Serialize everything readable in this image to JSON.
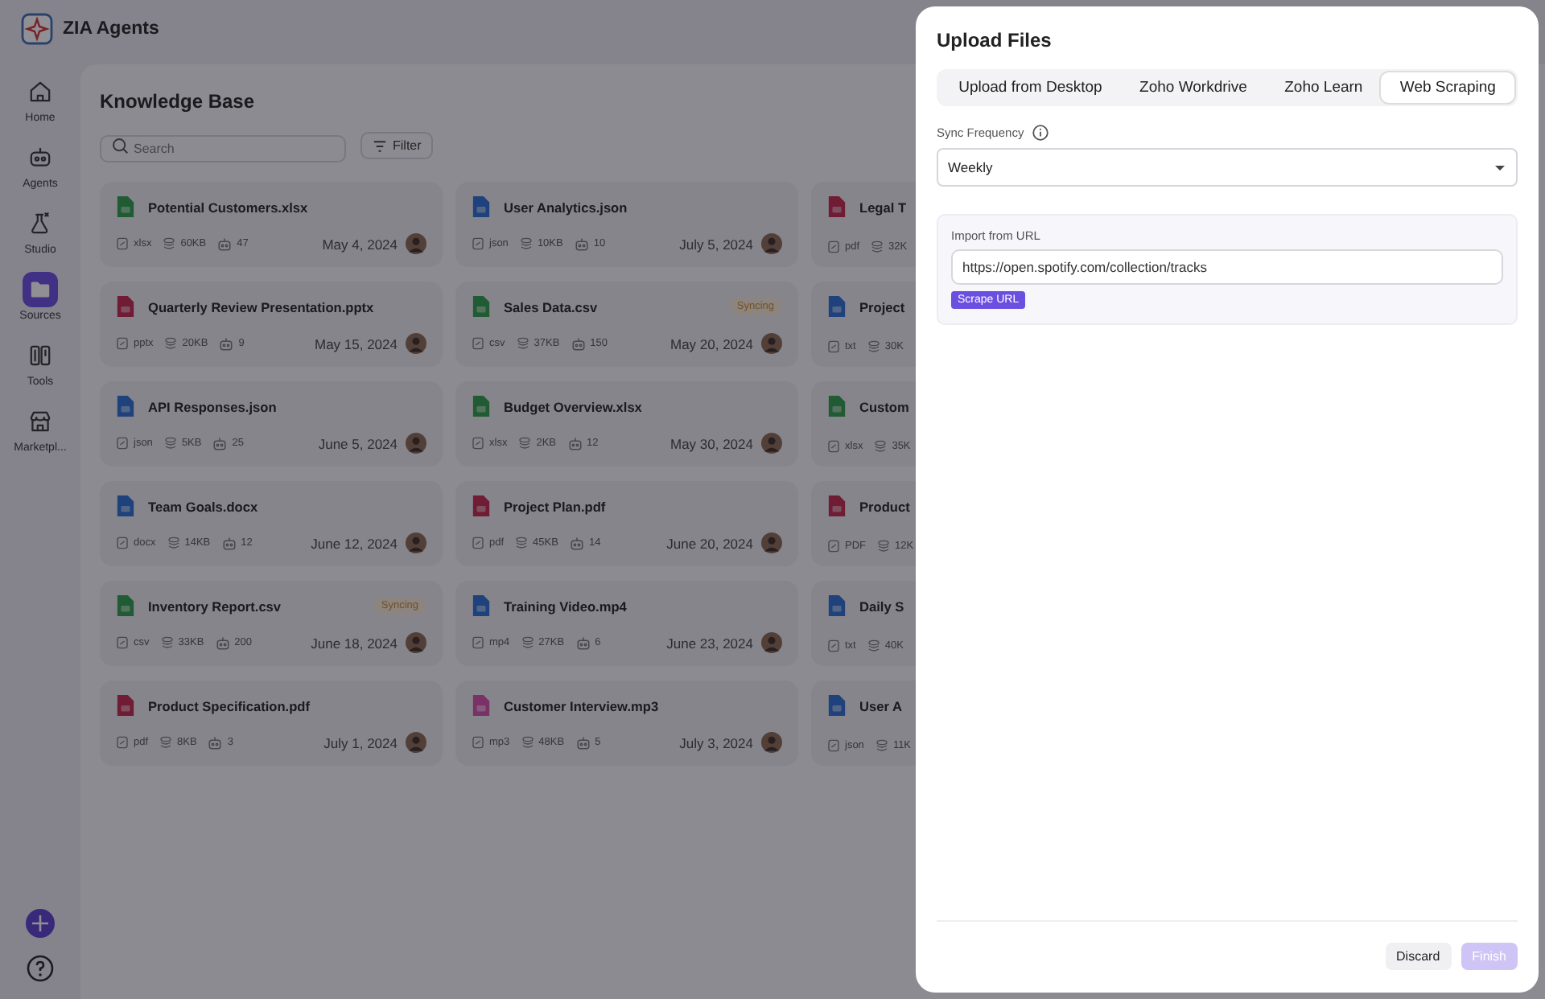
{
  "app": {
    "name": "ZIA Agents"
  },
  "sidebar": {
    "items": [
      {
        "label": "Home",
        "selected": false
      },
      {
        "label": "Agents",
        "selected": false
      },
      {
        "label": "Studio",
        "selected": false
      },
      {
        "label": "Sources",
        "selected": true
      },
      {
        "label": "Tools",
        "selected": false
      },
      {
        "label": "Marketpl...",
        "selected": false
      }
    ]
  },
  "page": {
    "title": "Knowledge Base",
    "search": {
      "placeholder": "Search"
    },
    "filter_button": "Filter"
  },
  "files": [
    {
      "name": "Potential Customers.xlsx",
      "kind": "sheet",
      "ext": "xlsx",
      "size": "60KB",
      "count": "47",
      "date": "May 4, 2024"
    },
    {
      "name": "User Analytics.json",
      "kind": "code",
      "ext": "json",
      "size": "10KB",
      "count": "10",
      "date": "July 5, 2024"
    },
    {
      "name": "Legal T",
      "kind": "pdf",
      "ext": "pdf",
      "size": "32K"
    },
    {
      "name": "Quarterly Review Presentation.pptx",
      "kind": "slides",
      "ext": "pptx",
      "size": "20KB",
      "count": "9",
      "date": "May 15, 2024"
    },
    {
      "name": "Sales Data.csv",
      "kind": "sheet",
      "ext": "csv",
      "size": "37KB",
      "count": "150",
      "date": "May 20, 2024",
      "badge": "Syncing"
    },
    {
      "name": "Project",
      "kind": "doc",
      "ext": "txt",
      "size": "30K"
    },
    {
      "name": "API Responses.json",
      "kind": "code",
      "ext": "json",
      "size": "5KB",
      "count": "25",
      "date": "June 5, 2024"
    },
    {
      "name": "Budget Overview.xlsx",
      "kind": "sheet",
      "ext": "xlsx",
      "size": "2KB",
      "count": "12",
      "date": "May 30, 2024"
    },
    {
      "name": "Custom",
      "kind": "sheet",
      "ext": "xlsx",
      "size": "35K"
    },
    {
      "name": "Team Goals.docx",
      "kind": "doc",
      "ext": "docx",
      "size": "14KB",
      "count": "12",
      "date": "June 12, 2024"
    },
    {
      "name": "Project Plan.pdf",
      "kind": "pdf",
      "ext": "pdf",
      "size": "45KB",
      "count": "14",
      "date": "June 20, 2024"
    },
    {
      "name": "Product",
      "kind": "slides",
      "ext": "PDF",
      "size": "12K"
    },
    {
      "name": "Inventory Report.csv",
      "kind": "sheet",
      "ext": "csv",
      "size": "33KB",
      "count": "200",
      "date": "June 18, 2024",
      "badge": "Syncing"
    },
    {
      "name": "Training Video.mp4",
      "kind": "video",
      "ext": "mp4",
      "size": "27KB",
      "count": "6",
      "date": "June 23, 2024"
    },
    {
      "name": "Daily S",
      "kind": "doc",
      "ext": "txt",
      "size": "40K"
    },
    {
      "name": "Product Specification.pdf",
      "kind": "pdf",
      "ext": "pdf",
      "size": "8KB",
      "count": "3",
      "date": "July 1, 2024"
    },
    {
      "name": "Customer Interview.mp3",
      "kind": "audio",
      "ext": "mp3",
      "size": "48KB",
      "count": "5",
      "date": "July 3, 2024"
    },
    {
      "name": "User A",
      "kind": "code",
      "ext": "json",
      "size": "11K"
    }
  ],
  "dialog": {
    "title": "Upload Files",
    "tabs": [
      {
        "label": "Upload from Desktop",
        "selected": false
      },
      {
        "label": "Zoho Workdrive",
        "selected": false
      },
      {
        "label": "Zoho Learn",
        "selected": false
      },
      {
        "label": "Web Scraping",
        "selected": true
      }
    ],
    "sync_frequency": {
      "label": "Sync Frequency",
      "value": "Weekly"
    },
    "import": {
      "label": "Import from URL",
      "value": "https://open.spotify.com/collection/tracks",
      "button": "Scrape URL"
    },
    "buttons": [
      {
        "label": "Discard",
        "disabled": false,
        "kind": "secondary"
      },
      {
        "label": "Finish",
        "disabled": true,
        "kind": "primary"
      }
    ]
  }
}
